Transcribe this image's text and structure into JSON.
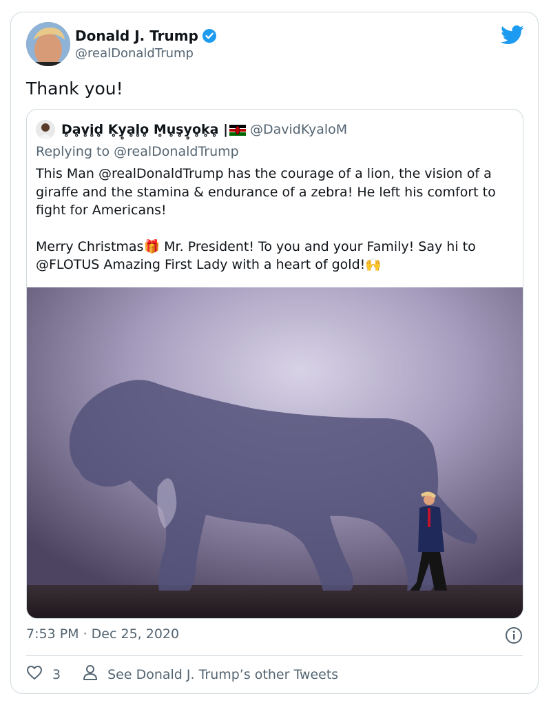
{
  "author": {
    "name": "Donald J. Trump",
    "handle": "@realDonaldTrump"
  },
  "tweet": {
    "text": "Thank you!"
  },
  "quoted_tweet": {
    "author_name": "D̥ḁv̥i̥d̥ K̥y̥ḁl̥o̥ M̥u̥s̥y̥o̥k̥ḁ |",
    "handle": "@DavidKyaloM",
    "replying_to": "Replying to @realDonaldTrump",
    "paragraph1": "This Man @realDonaldTrump has the courage of a lion, the vision of a giraffe and the stamina & endurance of a zebra! He left his comfort to fight for Americans!",
    "paragraph2": "Merry Christmas🎁 Mr. President! To you and your Family! Say hi to @FLOTUS Amazing First Lady with a heart of gold!🙌",
    "image_icon": "lion-shadow-photo"
  },
  "footer": {
    "timestamp": "7:53 PM · Dec 25, 2020",
    "like_count": "3",
    "others_label": "See Donald J. Trump’s other Tweets"
  },
  "colors": {
    "brand": "#1d9bf0",
    "text_secondary": "#536471",
    "border": "#cfd9de"
  },
  "icons": [
    "verified-badge-icon",
    "twitter-bird-icon",
    "info-icon",
    "heart-icon",
    "person-icon",
    "gift-emoji",
    "raised-hands-emoji",
    "kenya-flag-emoji"
  ]
}
